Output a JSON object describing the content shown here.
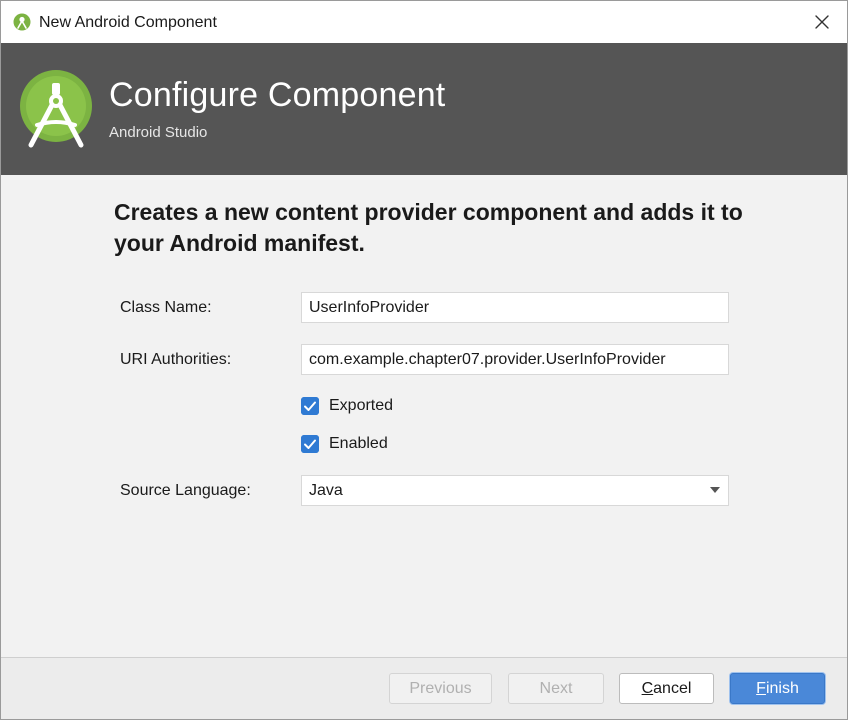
{
  "window": {
    "title": "New Android Component",
    "icon": "android-studio-icon",
    "close_icon": "close-icon"
  },
  "header": {
    "title": "Configure Component",
    "subtitle": "Android Studio",
    "logo_icon": "android-studio-logo",
    "background": "#555555"
  },
  "content": {
    "headline": "Creates a new content provider component and adds it to your Android manifest.",
    "class_name": {
      "label": "Class Name:",
      "value": "UserInfoProvider"
    },
    "uri_authorities": {
      "label": "URI Authorities:",
      "value": "com.example.chapter07.provider.UserInfoProvider"
    },
    "exported": {
      "label": "Exported",
      "checked": true
    },
    "enabled": {
      "label": "Enabled",
      "checked": true
    },
    "source_language": {
      "label": "Source Language:",
      "value": "Java"
    }
  },
  "footer": {
    "previous_label": "Previous",
    "next_label": "Next",
    "cancel_first": "C",
    "cancel_rest": "ancel",
    "finish_first": "F",
    "finish_rest": "inish"
  },
  "colors": {
    "accent": "#4a88d8",
    "checkbox": "#2f7ad3",
    "logo_green": "#7cb342"
  }
}
